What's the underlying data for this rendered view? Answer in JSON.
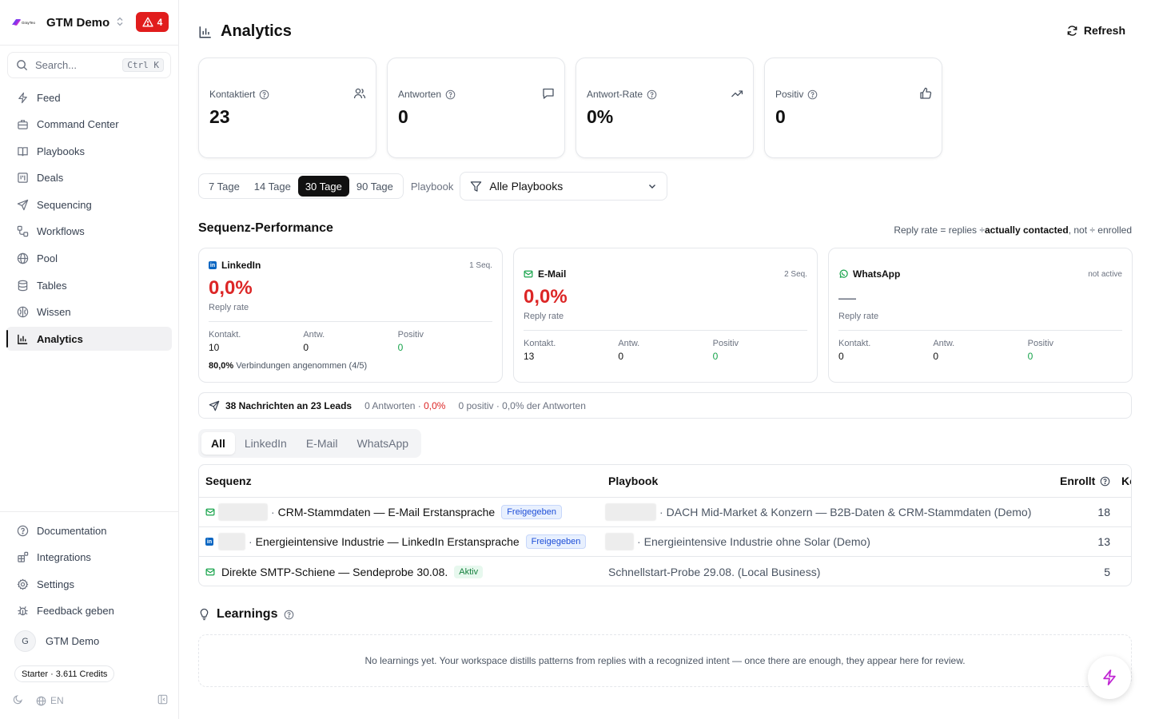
{
  "workspace": {
    "name": "GTM Demo",
    "alert_count": "4"
  },
  "search": {
    "placeholder": "Search...",
    "shortcut": "Ctrl K"
  },
  "nav": [
    {
      "label": "Feed",
      "icon": "bolt-icon"
    },
    {
      "label": "Command Center",
      "icon": "briefcase-icon"
    },
    {
      "label": "Playbooks",
      "icon": "book-icon"
    },
    {
      "label": "Deals",
      "icon": "kanban-icon"
    },
    {
      "label": "Sequencing",
      "icon": "send-icon"
    },
    {
      "label": "Workflows",
      "icon": "workflow-icon"
    },
    {
      "label": "Pool",
      "icon": "globe-icon"
    },
    {
      "label": "Tables",
      "icon": "database-icon"
    },
    {
      "label": "Wissen",
      "icon": "brain-icon"
    },
    {
      "label": "Analytics",
      "icon": "bar-chart-icon",
      "active": true
    }
  ],
  "nav_bottom": [
    {
      "label": "Documentation",
      "icon": "help-circle-icon"
    },
    {
      "label": "Integrations",
      "icon": "blocks-icon"
    },
    {
      "label": "Settings",
      "icon": "gear-icon"
    },
    {
      "label": "Feedback geben",
      "icon": "bug-icon"
    }
  ],
  "user": {
    "initial": "G",
    "name": "GTM Demo"
  },
  "plan": {
    "label": "Starter · 3.611 Credits"
  },
  "locale": {
    "lang": "EN"
  },
  "header": {
    "title": "Analytics",
    "refresh_label": "Refresh"
  },
  "kpis": [
    {
      "label": "Kontaktiert",
      "value": "23",
      "icon": "users-icon"
    },
    {
      "label": "Antworten",
      "value": "0",
      "icon": "message-icon"
    },
    {
      "label": "Antwort-Rate",
      "value": "0%",
      "icon": "trending-up-icon"
    },
    {
      "label": "Positiv",
      "value": "0",
      "icon": "thumbs-up-icon"
    }
  ],
  "filters": {
    "ranges": [
      "7 Tage",
      "14 Tage",
      "30 Tage",
      "90 Tage"
    ],
    "active_range": "30 Tage",
    "playbook_label": "Playbook",
    "playbook_value": "Alle Playbooks"
  },
  "sequence_performance": {
    "title": "Sequenz-Performance",
    "note_prefix": "Reply rate = replies ÷",
    "note_bold": "actually contacted",
    "note_suffix": ", not ÷ enrolled",
    "channels": [
      {
        "name": "LinkedIn",
        "count": "1 Seq.",
        "rate": "0,0%",
        "rate_label": "Reply rate",
        "kontakt_label": "Kontakt.",
        "kontakt": "10",
        "antw_label": "Antw.",
        "antw": "0",
        "positiv_label": "Positiv",
        "positiv": "0",
        "foot_bold": "80,0%",
        "foot_text": " Verbindungen angenommen (4/5)"
      },
      {
        "name": "E-Mail",
        "count": "2 Seq.",
        "rate": "0,0%",
        "rate_label": "Reply rate",
        "kontakt_label": "Kontakt.",
        "kontakt": "13",
        "antw_label": "Antw.",
        "antw": "0",
        "positiv_label": "Positiv",
        "positiv": "0"
      },
      {
        "name": "WhatsApp",
        "count": "not active",
        "rate": "—",
        "rate_label": "Reply rate",
        "kontakt_label": "Kontakt.",
        "kontakt": "0",
        "antw_label": "Antw.",
        "antw": "0",
        "positiv_label": "Positiv",
        "positiv": "0"
      }
    ]
  },
  "summary": {
    "messages": "38 Nachrichten an 23 Leads",
    "answers": "0 Antworten · ",
    "answers_rate": "0,0%",
    "positive": "0 positiv · 0,0% der Antworten"
  },
  "tabs": [
    "All",
    "LinkedIn",
    "E-Mail",
    "WhatsApp"
  ],
  "table": {
    "headers": {
      "sequence": "Sequenz",
      "playbook": "Playbook",
      "enrolled": "Enrollt",
      "contacted_cut": "Ko"
    },
    "rows": [
      {
        "channel": "email",
        "sequence": "CRM-Stammdaten — E-Mail Erstansprache",
        "status": "Freigegeben",
        "playbook": "DACH Mid-Market & Konzern — B2B-Daten & CRM-Stammdaten (Demo)",
        "enrolled": "18"
      },
      {
        "channel": "linkedin",
        "sequence": "Energieintensive Industrie — LinkedIn Erstansprache",
        "status": "Freigegeben",
        "playbook": "Energieintensive Industrie ohne Solar (Demo)",
        "enrolled": "13"
      },
      {
        "channel": "email",
        "sequence": "Direkte SMTP-Schiene — Sendeprobe 30.08.",
        "status": "Aktiv",
        "playbook": "Schnellstart-Probe 29.08. (Local Business)",
        "enrolled": "5"
      }
    ]
  },
  "learnings": {
    "title": "Learnings",
    "empty": "No learnings yet. Your workspace distills patterns from replies with a recognized intent — once there are enough, they appear here for review."
  },
  "colors": {
    "accent": "#111111",
    "danger": "#dc2626",
    "success": "#16a34a",
    "brand_fab": "#c026d3"
  }
}
